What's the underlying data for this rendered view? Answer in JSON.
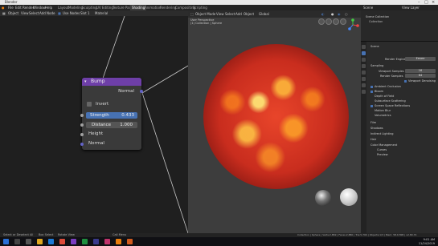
{
  "window": {
    "title": "Blender"
  },
  "menu": {
    "items": [
      "File",
      "Edit",
      "Render",
      "Window",
      "Help"
    ],
    "workspaces": [
      "Layout",
      "Modeling",
      "Sculpting",
      "UV Editing",
      "Texture Paint",
      "Shading",
      "Animation",
      "Rendering",
      "Compositing",
      "Scripting"
    ],
    "active_workspace": "Shading",
    "scene": "Scene",
    "view_layer": "View Layer"
  },
  "node_editor": {
    "header": {
      "object_mode": "Object",
      "view": "View",
      "select": "Select",
      "add": "Add",
      "node": "Node",
      "use_nodes": "Use Nodes",
      "slot": "Slot 1",
      "material": "Material"
    },
    "bump_node": {
      "title": "Bump",
      "output": "Normal",
      "invert_label": "Invert",
      "strength_label": "Strength",
      "strength_value": "0.433",
      "distance_label": "Distance",
      "distance_value": "1.000",
      "height_label": "Height",
      "normal_label": "Normal"
    }
  },
  "viewport": {
    "header": {
      "mode": "Object Mode",
      "view": "View",
      "select": "Select",
      "add": "Add",
      "object": "Object",
      "orientation": "Global"
    },
    "info_line1": "User Perspective",
    "info_line2": "(1) Collection | Sphere"
  },
  "properties": {
    "outliner": {
      "title": "Scene Collection",
      "items": [
        "Collection"
      ]
    },
    "object_name": "Scene",
    "render_engine_label": "Render Engine",
    "render_engine_value": "Eevee",
    "sampling_label": "Sampling",
    "viewport_samples_label": "Viewport Samples",
    "viewport_samples_value": "16",
    "render_samples_label": "Render Samples",
    "render_samples_value": "64",
    "viewport_denoising_label": "Viewport Denoising",
    "sections": [
      "Ambient Occlusion",
      "Bloom",
      "Depth of Field",
      "Subsurface Scattering",
      "Screen Space Reflections",
      "Motion Blur",
      "Volumetrics",
      "Film",
      "Shadows",
      "Indirect Lighting",
      "Hair",
      "Color Management"
    ],
    "subsections": [
      "Curves",
      "Preview"
    ]
  },
  "status": {
    "left1": "Select or Deselect All",
    "left2": "Box Select",
    "left3": "Rotate View",
    "left4": "Call Menu",
    "right": "Collection | Sphere | Verts:2,882 | Faces:2,880 | Tris:5,760 | Objects:1/3 | Mem: 58.6 MiB | v2.80.74"
  },
  "taskbar": {
    "time": "9:01 AM",
    "date": "11/24/2019"
  },
  "colors": {
    "node_header": "#6e3fa8",
    "socket_vector": "#6363c7",
    "socket_float": "#a1a1a1",
    "accent": "#4772b3"
  }
}
